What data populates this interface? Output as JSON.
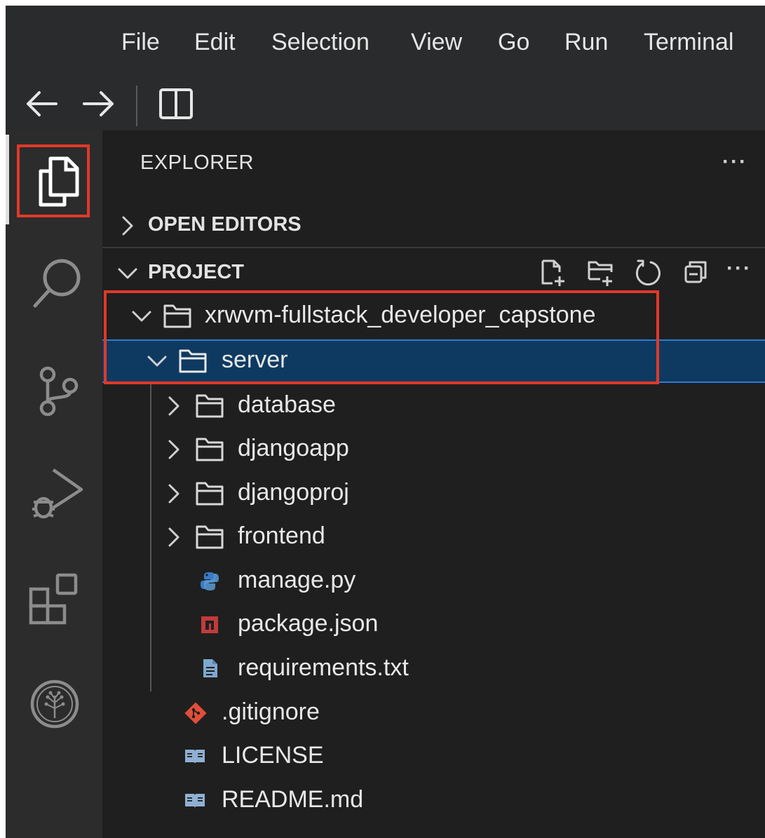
{
  "menu": [
    "File",
    "Edit",
    "Selection",
    "View",
    "Go",
    "Run",
    "Terminal"
  ],
  "sidebar": {
    "title": "EXPLORER",
    "more": "···",
    "open_editors": "OPEN EDITORS",
    "project": "PROJECT",
    "project_more": "···"
  },
  "tree": [
    {
      "label": "xrwvm-fullstack_developer_capstone",
      "type": "folder",
      "expanded": true
    },
    {
      "label": "server",
      "type": "folder",
      "expanded": true
    },
    {
      "label": "database",
      "type": "folder",
      "expanded": false
    },
    {
      "label": "djangoapp",
      "type": "folder",
      "expanded": false
    },
    {
      "label": "djangoproj",
      "type": "folder",
      "expanded": false
    },
    {
      "label": "frontend",
      "type": "folder",
      "expanded": false
    },
    {
      "label": "manage.py",
      "type": "python-file"
    },
    {
      "label": "package.json",
      "type": "npm-file"
    },
    {
      "label": "requirements.txt",
      "type": "text-file"
    },
    {
      "label": ".gitignore",
      "type": "git-file"
    },
    {
      "label": "LICENSE",
      "type": "book-file"
    },
    {
      "label": "README.md",
      "type": "book-file"
    }
  ],
  "colors": {
    "highlight": "#e0392a",
    "selection": "#0e3a61",
    "python": "#3a7bc8",
    "npm": "#c23b3b",
    "git": "#e04e39"
  }
}
